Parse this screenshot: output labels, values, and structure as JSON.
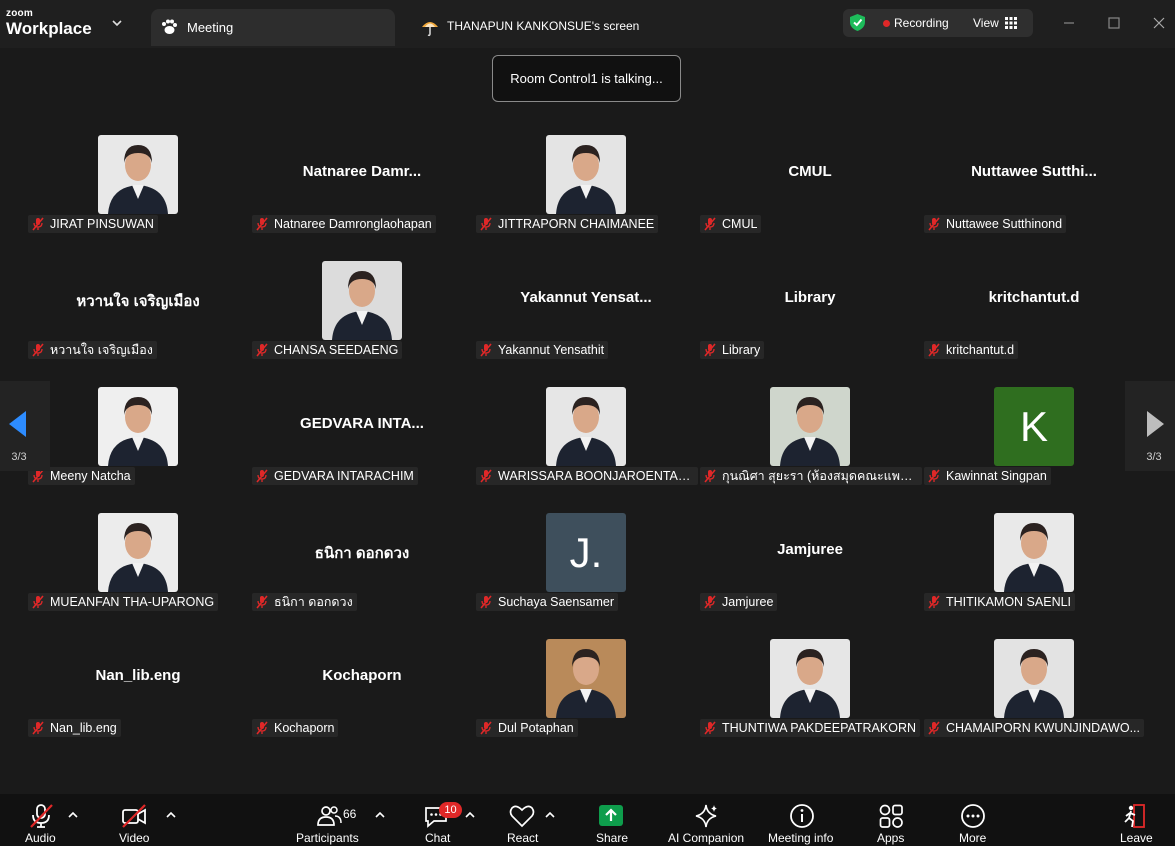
{
  "app": {
    "brand_line1": "zoom",
    "brand_line2": "Workplace",
    "tab_meeting": "Meeting",
    "tab_share": "THANAPUN KANKONSUE's screen",
    "recording_label": "Recording",
    "view_label": "View"
  },
  "talking_banner": "Room Control1 is talking...",
  "participants": [
    {
      "name": "JIRAT PINSUWAN",
      "display": "",
      "type": "photo",
      "tone": "#e8e8e8"
    },
    {
      "name": "Natnaree Damronglaohapan",
      "display": "Natnaree  Damr...",
      "type": "name"
    },
    {
      "name": "JITTRAPORN CHAIMANEE",
      "display": "",
      "type": "photo",
      "tone": "#e4e4e4"
    },
    {
      "name": "CMUL",
      "display": "CMUL",
      "type": "name"
    },
    {
      "name": "Nuttawee Sutthinond",
      "display": "Nuttawee  Sutthi...",
      "type": "name"
    },
    {
      "name": "หวานใจ เจริญเมือง",
      "display": "หวานใจ เจริญเมือง",
      "type": "name"
    },
    {
      "name": "CHANSA SEEDAENG",
      "display": "",
      "type": "photo",
      "tone": "#dcdcdc"
    },
    {
      "name": "Yakannut Yensathit",
      "display": "Yakannut  Yensat...",
      "type": "name"
    },
    {
      "name": "Library",
      "display": "Library",
      "type": "name"
    },
    {
      "name": "kritchantut.d",
      "display": "kritchantut.d",
      "type": "name"
    },
    {
      "name": "Meeny Natcha",
      "display": "",
      "type": "photo",
      "tone": "#efefef"
    },
    {
      "name": "GEDVARA INTARACHIM",
      "display": "GEDVARA  INTA...",
      "type": "name"
    },
    {
      "name": "WARISSARA BOONJAROENTANG...",
      "display": "",
      "type": "photo",
      "tone": "#e6e6e6"
    },
    {
      "name": "กุนณิศา สุยะรา (ห้องสมุดคณะแพทย์ ม...",
      "display": "",
      "type": "photo",
      "tone": "#cfd6cc"
    },
    {
      "name": "Kawinnat Singpan",
      "display": "",
      "type": "letter",
      "letter": "K",
      "color": "#2f6e1f"
    },
    {
      "name": "MUEANFAN THA-UPARONG",
      "display": "",
      "type": "photo",
      "tone": "#ececec"
    },
    {
      "name": "ธนิกา ดอกดวง",
      "display": "ธนิกา ดอกดวง",
      "type": "name"
    },
    {
      "name": "Suchaya Saensamer",
      "display": "",
      "type": "letter",
      "letter": "J.",
      "color": "#3e4f5c"
    },
    {
      "name": "Jamjuree",
      "display": "Jamjuree",
      "type": "name"
    },
    {
      "name": "THITIKAMON SAENLI",
      "display": "",
      "type": "photo",
      "tone": "#e9e9e9"
    },
    {
      "name": "Nan_lib.eng",
      "display": "Nan_lib.eng",
      "type": "name"
    },
    {
      "name": "Kochaporn",
      "display": "Kochaporn",
      "type": "name"
    },
    {
      "name": "Dul Potaphan",
      "display": "",
      "type": "photo",
      "tone": "#b98a5a"
    },
    {
      "name": "THUNTIWA PAKDEEPATRAKORN",
      "display": "",
      "type": "photo",
      "tone": "#e6e6e6"
    },
    {
      "name": "CHAMAIPORN KWUNJINDAWO...",
      "display": "",
      "type": "photo",
      "tone": "#e3e3e3"
    }
  ],
  "page_indicator": {
    "left": "3/3",
    "right": "3/3"
  },
  "toolbar": {
    "audio": "Audio",
    "video": "Video",
    "participants": "Participants",
    "participants_count": "66",
    "chat": "Chat",
    "chat_badge": "10",
    "react": "React",
    "share": "Share",
    "ai_companion": "AI Companion",
    "meeting_info": "Meeting info",
    "apps": "Apps",
    "more": "More",
    "leave": "Leave"
  },
  "colors": {
    "background": "#1a1a1a",
    "share_green": "#0e9d4c",
    "recording_red": "#e02828",
    "muted_red": "#e02828",
    "nav_arrow_blue": "#2d8cff"
  }
}
